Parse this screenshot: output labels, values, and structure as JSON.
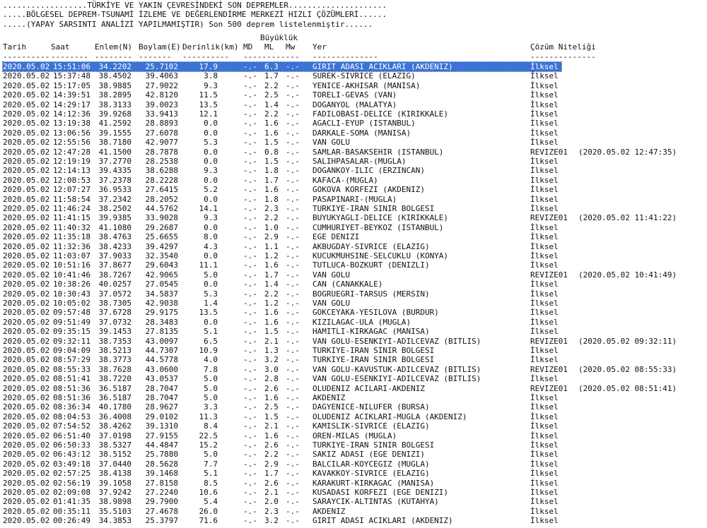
{
  "banner": {
    "line1": "..................TÜRKİYE VE YAKIN ÇEVRESİNDEKİ SON DEPREMLER.....................",
    "line2": ".....BÖLGESEL DEPREM-TSUNAMİ İZLEME VE DEĞERLENDİRME MERKEZİ HIZLI ÇÖZÜMLERİ......",
    "line3": ".....(YAPAY SARSINTI ANALİZİ YAPILMAMIŞTIR) Son 500 deprem listelenmiştir......"
  },
  "columns": {
    "magnitude_group": "Büyüklük",
    "date": "Tarih",
    "time": "Saat",
    "lat": "Enlem(N)",
    "lon": "Boylam(E)",
    "depth": "Derinlik(km)",
    "md": "MD",
    "ml": "ML",
    "mw": "Mw",
    "place": "Yer",
    "quality": "Çözüm Niteliği",
    "underline_date": "----------",
    "underline_time": "--------",
    "underline_lat": "--------",
    "underline_lon": "-------",
    "underline_depth": "----------",
    "underline_mag": "------------",
    "underline_place": "--------------",
    "underline_quality": "--------------"
  },
  "rows": [
    {
      "date": "2020.05.02",
      "time": "15:51:06",
      "lat": "34.2202",
      "lon": "25.7102",
      "depth": "17.9",
      "md": "-.-",
      "ml": "6.3",
      "mw": "-.-",
      "place": "GIRIT ADASI ACIKLARI (AKDENIZ)",
      "quality": "İlksel",
      "revised": ""
    },
    {
      "date": "2020.05.02",
      "time": "15:37:48",
      "lat": "38.4502",
      "lon": "39.4063",
      "depth": "3.8",
      "md": "-.-",
      "ml": "1.7",
      "mw": "-.-",
      "place": "SUREK-SIVRICE (ELAZIG)",
      "quality": "İlksel",
      "revised": ""
    },
    {
      "date": "2020.05.02",
      "time": "15:17:05",
      "lat": "38.9885",
      "lon": "27.9022",
      "depth": "9.3",
      "md": "-.-",
      "ml": "2.2",
      "mw": "-.-",
      "place": "YENICE-AKHISAR (MANISA)",
      "quality": "İlksel",
      "revised": ""
    },
    {
      "date": "2020.05.02",
      "time": "14:39:51",
      "lat": "38.2895",
      "lon": "42.8120",
      "depth": "11.5",
      "md": "-.-",
      "ml": "2.5",
      "mw": "-.-",
      "place": "TORELI-GEVAS (VAN)",
      "quality": "İlksel",
      "revised": ""
    },
    {
      "date": "2020.05.02",
      "time": "14:29:17",
      "lat": "38.3133",
      "lon": "39.0023",
      "depth": "13.5",
      "md": "-.-",
      "ml": "1.4",
      "mw": "-.-",
      "place": "DOGANYOL (MALATYA)",
      "quality": "İlksel",
      "revised": ""
    },
    {
      "date": "2020.05.02",
      "time": "14:12:36",
      "lat": "39.9268",
      "lon": "33.9413",
      "depth": "12.1",
      "md": "-.-",
      "ml": "2.2",
      "mw": "-.-",
      "place": "FADILOBASI-DELICE (KIRIKKALE)",
      "quality": "İlksel",
      "revised": ""
    },
    {
      "date": "2020.05.02",
      "time": "13:19:38",
      "lat": "41.2592",
      "lon": "28.8893",
      "depth": "0.0",
      "md": "-.-",
      "ml": "1.6",
      "mw": "-.-",
      "place": "AGACLI-EYUP (ISTANBUL)",
      "quality": "İlksel",
      "revised": ""
    },
    {
      "date": "2020.05.02",
      "time": "13:06:56",
      "lat": "39.1555",
      "lon": "27.6078",
      "depth": "0.0",
      "md": "-.-",
      "ml": "1.6",
      "mw": "-.-",
      "place": "DARKALE-SOMA (MANISA)",
      "quality": "İlksel",
      "revised": ""
    },
    {
      "date": "2020.05.02",
      "time": "12:55:56",
      "lat": "38.7180",
      "lon": "42.9077",
      "depth": "5.3",
      "md": "-.-",
      "ml": "1.5",
      "mw": "-.-",
      "place": "VAN GOLU",
      "quality": "İlksel",
      "revised": ""
    },
    {
      "date": "2020.05.02",
      "time": "12:47:28",
      "lat": "41.1500",
      "lon": "28.7878",
      "depth": "0.0",
      "md": "-.-",
      "ml": "0.8",
      "mw": "-.-",
      "place": "SAMLAR-BASAKSEHIR (ISTANBUL)",
      "quality": "REVIZE01",
      "revised": "(2020.05.02 12:47:35)"
    },
    {
      "date": "2020.05.02",
      "time": "12:19:19",
      "lat": "37.2770",
      "lon": "28.2538",
      "depth": "0.0",
      "md": "-.-",
      "ml": "1.5",
      "mw": "-.-",
      "place": "SALIHPASALAR-(MUGLA)",
      "quality": "İlksel",
      "revised": ""
    },
    {
      "date": "2020.05.02",
      "time": "12:14:13",
      "lat": "39.4335",
      "lon": "38.6288",
      "depth": "9.3",
      "md": "-.-",
      "ml": "1.8",
      "mw": "-.-",
      "place": "DOGANKOY-ILIC (ERZINCAN)",
      "quality": "İlksel",
      "revised": ""
    },
    {
      "date": "2020.05.02",
      "time": "12:08:53",
      "lat": "37.2378",
      "lon": "28.2228",
      "depth": "0.0",
      "md": "-.-",
      "ml": "1.7",
      "mw": "-.-",
      "place": "KAFACA-(MUGLA)",
      "quality": "İlksel",
      "revised": ""
    },
    {
      "date": "2020.05.02",
      "time": "12:07:27",
      "lat": "36.9533",
      "lon": "27.6415",
      "depth": "5.2",
      "md": "-.-",
      "ml": "1.6",
      "mw": "-.-",
      "place": "GOKOVA KORFEZI (AKDENIZ)",
      "quality": "İlksel",
      "revised": ""
    },
    {
      "date": "2020.05.02",
      "time": "11:58:54",
      "lat": "37.2342",
      "lon": "28.2052",
      "depth": "0.0",
      "md": "-.-",
      "ml": "1.8",
      "mw": "-.-",
      "place": "PASAPINARI-(MUGLA)",
      "quality": "İlksel",
      "revised": ""
    },
    {
      "date": "2020.05.02",
      "time": "11:46:24",
      "lat": "38.2502",
      "lon": "44.5762",
      "depth": "14.1",
      "md": "-.-",
      "ml": "2.3",
      "mw": "-.-",
      "place": "TURKIYE-IRAN SINIR BOLGESI",
      "quality": "İlksel",
      "revised": ""
    },
    {
      "date": "2020.05.02",
      "time": "11:41:15",
      "lat": "39.9385",
      "lon": "33.9028",
      "depth": "9.3",
      "md": "-.-",
      "ml": "2.2",
      "mw": "-.-",
      "place": "BUYUKYAGLI-DELICE (KIRIKKALE)",
      "quality": "REVIZE01",
      "revised": "(2020.05.02 11:41:22)"
    },
    {
      "date": "2020.05.02",
      "time": "11:40:32",
      "lat": "41.1080",
      "lon": "29.2687",
      "depth": "0.0",
      "md": "-.-",
      "ml": "1.0",
      "mw": "-.-",
      "place": "CUMHURIYET-BEYKOZ (ISTANBUL)",
      "quality": "İlksel",
      "revised": ""
    },
    {
      "date": "2020.05.02",
      "time": "11:35:18",
      "lat": "38.4763",
      "lon": "25.6655",
      "depth": "8.0",
      "md": "-.-",
      "ml": "2.9",
      "mw": "-.-",
      "place": "EGE DENIZI",
      "quality": "İlksel",
      "revised": ""
    },
    {
      "date": "2020.05.02",
      "time": "11:32:36",
      "lat": "38.4233",
      "lon": "39.4297",
      "depth": "4.3",
      "md": "-.-",
      "ml": "1.1",
      "mw": "-.-",
      "place": "AKBUGDAY-SIVRICE (ELAZIG)",
      "quality": "İlksel",
      "revised": ""
    },
    {
      "date": "2020.05.02",
      "time": "11:03:07",
      "lat": "37.9033",
      "lon": "32.3540",
      "depth": "0.0",
      "md": "-.-",
      "ml": "1.2",
      "mw": "-.-",
      "place": "KUCUKMUHSINE-SELCUKLU (KONYA)",
      "quality": "İlksel",
      "revised": ""
    },
    {
      "date": "2020.05.02",
      "time": "10:51:16",
      "lat": "37.8677",
      "lon": "29.6043",
      "depth": "11.1",
      "md": "-.-",
      "ml": "1.6",
      "mw": "-.-",
      "place": "TUTLUCA-BOZKURT (DENIZLI)",
      "quality": "İlksel",
      "revised": ""
    },
    {
      "date": "2020.05.02",
      "time": "10:41:46",
      "lat": "38.7267",
      "lon": "42.9065",
      "depth": "5.0",
      "md": "-.-",
      "ml": "1.7",
      "mw": "-.-",
      "place": "VAN GOLU",
      "quality": "REVIZE01",
      "revised": "(2020.05.02 10:41:49)"
    },
    {
      "date": "2020.05.02",
      "time": "10:38:26",
      "lat": "40.0257",
      "lon": "27.0545",
      "depth": "0.0",
      "md": "-.-",
      "ml": "1.4",
      "mw": "-.-",
      "place": "CAN (CANAKKALE)",
      "quality": "İlksel",
      "revised": ""
    },
    {
      "date": "2020.05.02",
      "time": "10:30:43",
      "lat": "37.0572",
      "lon": "34.5837",
      "depth": "5.3",
      "md": "-.-",
      "ml": "2.2",
      "mw": "-.-",
      "place": "BOGRUEGRI-TARSUS (MERSIN)",
      "quality": "İlksel",
      "revised": ""
    },
    {
      "date": "2020.05.02",
      "time": "10:05:02",
      "lat": "38.7305",
      "lon": "42.9038",
      "depth": "1.4",
      "md": "-.-",
      "ml": "1.2",
      "mw": "-.-",
      "place": "VAN GOLU",
      "quality": "İlksel",
      "revised": ""
    },
    {
      "date": "2020.05.02",
      "time": "09:57:48",
      "lat": "37.6728",
      "lon": "29.9175",
      "depth": "13.5",
      "md": "-.-",
      "ml": "1.6",
      "mw": "-.-",
      "place": "GOKCEYAKA-YESILOVA (BURDUR)",
      "quality": "İlksel",
      "revised": ""
    },
    {
      "date": "2020.05.02",
      "time": "09:51:49",
      "lat": "37.0732",
      "lon": "28.3483",
      "depth": "0.0",
      "md": "-.-",
      "ml": "1.6",
      "mw": "-.-",
      "place": "KIZILAGAC-ULA (MUGLA)",
      "quality": "İlksel",
      "revised": ""
    },
    {
      "date": "2020.05.02",
      "time": "09:35:15",
      "lat": "39.1453",
      "lon": "27.8135",
      "depth": "5.1",
      "md": "-.-",
      "ml": "1.5",
      "mw": "-.-",
      "place": "HAMITLI-KIRKAGAC (MANISA)",
      "quality": "İlksel",
      "revised": ""
    },
    {
      "date": "2020.05.02",
      "time": "09:32:11",
      "lat": "38.7353",
      "lon": "43.0097",
      "depth": "6.5",
      "md": "-.-",
      "ml": "2.1",
      "mw": "-.-",
      "place": "VAN GOLU-ESENKIYI-ADILCEVAZ (BITLIS)",
      "quality": "REVIZE01",
      "revised": "(2020.05.02 09:32:11)"
    },
    {
      "date": "2020.05.02",
      "time": "09:04:09",
      "lat": "38.5213",
      "lon": "44.7307",
      "depth": "10.9",
      "md": "-.-",
      "ml": "1.3",
      "mw": "-.-",
      "place": "TURKIYE-IRAN SINIR BOLGESI",
      "quality": "İlksel",
      "revised": ""
    },
    {
      "date": "2020.05.02",
      "time": "08:57:29",
      "lat": "38.3773",
      "lon": "44.5778",
      "depth": "4.0",
      "md": "-.-",
      "ml": "3.2",
      "mw": "-.-",
      "place": "TURKIYE-IRAN SINIR BOLGESI",
      "quality": "İlksel",
      "revised": ""
    },
    {
      "date": "2020.05.02",
      "time": "08:55:33",
      "lat": "38.7628",
      "lon": "43.0600",
      "depth": "7.8",
      "md": "-.-",
      "ml": "3.0",
      "mw": "-.-",
      "place": "VAN GOLU-KAVUSTUK-ADILCEVAZ (BITLIS)",
      "quality": "REVIZE01",
      "revised": "(2020.05.02 08:55:33)"
    },
    {
      "date": "2020.05.02",
      "time": "08:51:41",
      "lat": "38.7220",
      "lon": "43.0537",
      "depth": "5.0",
      "md": "-.-",
      "ml": "2.8",
      "mw": "-.-",
      "place": "VAN GOLU-ESENKIYI-ADILCEVAZ (BITLIS)",
      "quality": "İlksel",
      "revised": ""
    },
    {
      "date": "2020.05.02",
      "time": "08:51:36",
      "lat": "36.5187",
      "lon": "28.7047",
      "depth": "5.0",
      "md": "-.-",
      "ml": "2.6",
      "mw": "-.-",
      "place": "OLUDENIZ ACILARI-AKDENIZ",
      "quality": "REVIZE01",
      "revised": "(2020.05.02 08:51:41)"
    },
    {
      "date": "2020.05.02",
      "time": "08:51:36",
      "lat": "36.5187",
      "lon": "28.7047",
      "depth": "5.0",
      "md": "-.-",
      "ml": "1.6",
      "mw": "-.-",
      "place": "AKDENIZ",
      "quality": "İlksel",
      "revised": ""
    },
    {
      "date": "2020.05.02",
      "time": "08:36:34",
      "lat": "40.1780",
      "lon": "28.9627",
      "depth": "3.3",
      "md": "-.-",
      "ml": "2.5",
      "mw": "-.-",
      "place": "DAGYENICE-NILUFER (BURSA)",
      "quality": "İlksel",
      "revised": ""
    },
    {
      "date": "2020.05.02",
      "time": "08:04:53",
      "lat": "36.4008",
      "lon": "29.0102",
      "depth": "11.3",
      "md": "-.-",
      "ml": "1.5",
      "mw": "-.-",
      "place": "OLUDENIZ ACIKLARI-MUGLA (AKDENIZ)",
      "quality": "İlksel",
      "revised": ""
    },
    {
      "date": "2020.05.02",
      "time": "07:54:52",
      "lat": "38.4262",
      "lon": "39.1310",
      "depth": "8.4",
      "md": "-.-",
      "ml": "2.1",
      "mw": "-.-",
      "place": "KAMISLIK-SIVRICE (ELAZIG)",
      "quality": "İlksel",
      "revised": ""
    },
    {
      "date": "2020.05.02",
      "time": "06:51:40",
      "lat": "37.0198",
      "lon": "27.9155",
      "depth": "22.5",
      "md": "-.-",
      "ml": "1.6",
      "mw": "-.-",
      "place": "OREN-MILAS (MUGLA)",
      "quality": "İlksel",
      "revised": ""
    },
    {
      "date": "2020.05.02",
      "time": "06:50:33",
      "lat": "38.5327",
      "lon": "44.4847",
      "depth": "15.2",
      "md": "-.-",
      "ml": "2.6",
      "mw": "-.-",
      "place": "TURKIYE-IRAN SINIR BOLGESI",
      "quality": "İlksel",
      "revised": ""
    },
    {
      "date": "2020.05.02",
      "time": "06:43:12",
      "lat": "38.5152",
      "lon": "25.7880",
      "depth": "5.0",
      "md": "-.-",
      "ml": "2.2",
      "mw": "-.-",
      "place": "SAKIZ ADASI (EGE DENIZI)",
      "quality": "İlksel",
      "revised": ""
    },
    {
      "date": "2020.05.02",
      "time": "03:49:18",
      "lat": "37.0440",
      "lon": "28.5628",
      "depth": "7.7",
      "md": "-.-",
      "ml": "2.9",
      "mw": "-.-",
      "place": "BALCILAR-KOYCEGIZ (MUGLA)",
      "quality": "İlksel",
      "revised": ""
    },
    {
      "date": "2020.05.02",
      "time": "02:57:25",
      "lat": "38.4138",
      "lon": "39.1468",
      "depth": "5.1",
      "md": "-.-",
      "ml": "1.7",
      "mw": "-.-",
      "place": "KAVAKKOY-SIVRICE (ELAZIG)",
      "quality": "İlksel",
      "revised": ""
    },
    {
      "date": "2020.05.02",
      "time": "02:56:19",
      "lat": "39.1058",
      "lon": "27.8158",
      "depth": "8.5",
      "md": "-.-",
      "ml": "2.6",
      "mw": "-.-",
      "place": "KARAKURT-KIRKAGAC (MANISA)",
      "quality": "İlksel",
      "revised": ""
    },
    {
      "date": "2020.05.02",
      "time": "02:09:08",
      "lat": "37.9242",
      "lon": "27.2240",
      "depth": "10.6",
      "md": "-.-",
      "ml": "2.1",
      "mw": "-.-",
      "place": "KUSADASI KORFEZI (EGE DENIZI)",
      "quality": "İlksel",
      "revised": ""
    },
    {
      "date": "2020.05.02",
      "time": "01:41:35",
      "lat": "38.9898",
      "lon": "29.7900",
      "depth": "5.4",
      "md": "-.-",
      "ml": "2.0",
      "mw": "-.-",
      "place": "SARAYCIK-ALTINTAS (KUTAHYA)",
      "quality": "İlksel",
      "revised": ""
    },
    {
      "date": "2020.05.02",
      "time": "00:35:11",
      "lat": "35.5103",
      "lon": "27.4678",
      "depth": "26.0",
      "md": "-.-",
      "ml": "2.3",
      "mw": "-.-",
      "place": "AKDENIZ",
      "quality": "İlksel",
      "revised": ""
    },
    {
      "date": "2020.05.02",
      "time": "00:26:49",
      "lat": "34.3853",
      "lon": "25.3797",
      "depth": "71.6",
      "md": "-.-",
      "ml": "3.2",
      "mw": "-.-",
      "place": "GIRIT ADASI ACIKLARI (AKDENIZ)",
      "quality": "İlksel",
      "revised": ""
    }
  ]
}
